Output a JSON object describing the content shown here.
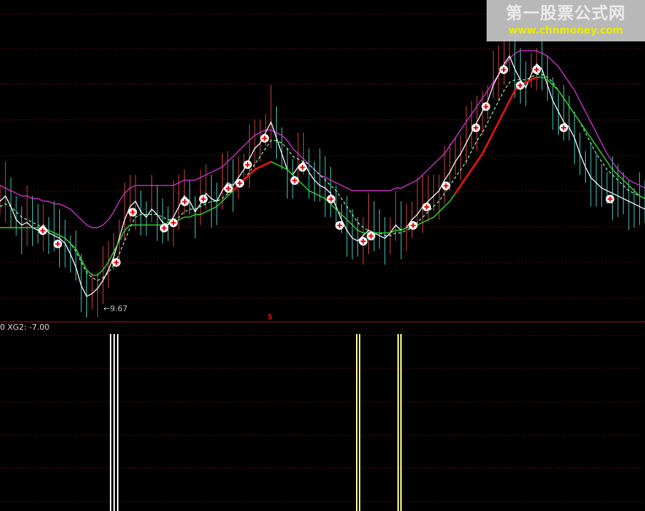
{
  "colors": {
    "background": "#000000",
    "grid": "#8b1a1a",
    "separator": "#b01818",
    "price_line": "#ffffff",
    "ma_dashed": "#8cffb0",
    "upper_band": "#cc33cc",
    "lower_support_green": "#33dd33",
    "lower_support_red": "#ee1111",
    "marker_fill": "#ffffff",
    "marker_cross": "#ee0000",
    "bar_white": "#ffffff",
    "bar_yellow": "#ffff88",
    "text_label": "#c0c0c0",
    "signal_red": "#ff2222"
  },
  "main_panel": {
    "low_label": "←9.67",
    "signal_marker": "$"
  },
  "indicator_panel": {
    "header": "0 XG2: -7.00"
  },
  "watermark": {
    "title": "第一股票公式网",
    "url": "www.chnmoney.com"
  },
  "chart_data": {
    "type": "line",
    "title": "",
    "xlabel": "",
    "ylabel": "",
    "note_values_relative": "y values relative to visible price range (0 = bottom, 100 = top of main panel)",
    "x": [
      0,
      1,
      2,
      3,
      4,
      5,
      6,
      7,
      8,
      9,
      10,
      11,
      12,
      13,
      14,
      15,
      16,
      17,
      18,
      19,
      20,
      21,
      22,
      23,
      24,
      25,
      26,
      27,
      28,
      29,
      30,
      31,
      32,
      33,
      34,
      35,
      36,
      37,
      38,
      39,
      40,
      41,
      42,
      43,
      44,
      45,
      46,
      47,
      48,
      49,
      50,
      51,
      52,
      53,
      54,
      55,
      56,
      57,
      58,
      59,
      60,
      61,
      62,
      63,
      64,
      65,
      66,
      67,
      68,
      69,
      70,
      71,
      72,
      73,
      74,
      75,
      76,
      77,
      78,
      79,
      80,
      81,
      82,
      83,
      84,
      85,
      86,
      87,
      88,
      89,
      90,
      91,
      92,
      93,
      94,
      95,
      96,
      97,
      98,
      99,
      100,
      101,
      102,
      103,
      104,
      105,
      106,
      107,
      108,
      109,
      110,
      111,
      112,
      113,
      114,
      115,
      116,
      117,
      118,
      119
    ],
    "series": [
      {
        "key": "price",
        "values": [
          40,
          42,
          38,
          33,
          31,
          32,
          30,
          29,
          31,
          28,
          27,
          26,
          24,
          20,
          15,
          8,
          4,
          5,
          7,
          10,
          14,
          19,
          26,
          33,
          38,
          40,
          36,
          34,
          37,
          35,
          32,
          31,
          34,
          38,
          42,
          40,
          36,
          39,
          43,
          41,
          40,
          44,
          47,
          46,
          49,
          52,
          56,
          60,
          62,
          66,
          70,
          64,
          58,
          52,
          50,
          53,
          55,
          51,
          48,
          46,
          45,
          43,
          38,
          33,
          29,
          26,
          25,
          27,
          29,
          28,
          27,
          26,
          28,
          31,
          29,
          30,
          33,
          35,
          38,
          40,
          42,
          44,
          48,
          51,
          55,
          58,
          62,
          66,
          70,
          74,
          78,
          84,
          88,
          92,
          95,
          90,
          86,
          83,
          88,
          92,
          90,
          84,
          78,
          74,
          70,
          68,
          64,
          58,
          53,
          49,
          47,
          45,
          44,
          43,
          42,
          41,
          40,
          39,
          38,
          37
        ]
      },
      {
        "key": "ma_dashed",
        "values": [
          38,
          39,
          38,
          36,
          34,
          33,
          32,
          31,
          30,
          29,
          28,
          27,
          26,
          24,
          21,
          17,
          13,
          11,
          10,
          11,
          13,
          16,
          20,
          25,
          30,
          34,
          35,
          35,
          35,
          35,
          34,
          33,
          33,
          34,
          36,
          37,
          37,
          38,
          39,
          40,
          40,
          41,
          43,
          44,
          46,
          48,
          51,
          54,
          57,
          60,
          63,
          63,
          62,
          60,
          57,
          56,
          55,
          54,
          52,
          50,
          48,
          46,
          44,
          41,
          38,
          35,
          32,
          30,
          29,
          28,
          28,
          27,
          27,
          28,
          28,
          29,
          30,
          32,
          34,
          36,
          38,
          40,
          43,
          46,
          49,
          52,
          55,
          59,
          63,
          66,
          70,
          74,
          78,
          82,
          85,
          86,
          86,
          86,
          87,
          88,
          88,
          87,
          85,
          82,
          79,
          76,
          73,
          70,
          66,
          62,
          58,
          55,
          52,
          50,
          48,
          46,
          44,
          43,
          42,
          41
        ]
      },
      {
        "key": "upper_band",
        "values": [
          46,
          45,
          44,
          43,
          42,
          42,
          41,
          41,
          40,
          40,
          39,
          39,
          38,
          37,
          35,
          33,
          31,
          30,
          30,
          31,
          33,
          36,
          40,
          43,
          45,
          46,
          46,
          46,
          46,
          46,
          46,
          46,
          46,
          47,
          48,
          48,
          48,
          49,
          50,
          51,
          52,
          53,
          55,
          57,
          59,
          61,
          63,
          65,
          66,
          67,
          67,
          66,
          65,
          63,
          60,
          58,
          56,
          54,
          52,
          50,
          49,
          48,
          47,
          46,
          45,
          44,
          44,
          44,
          44,
          44,
          44,
          44,
          44,
          45,
          45,
          46,
          47,
          48,
          50,
          52,
          54,
          56,
          58,
          61,
          64,
          67,
          70,
          73,
          76,
          79,
          82,
          85,
          88,
          91,
          94,
          96,
          97,
          97,
          97,
          97,
          96,
          95,
          93,
          91,
          88,
          85,
          82,
          78,
          74,
          70,
          66,
          62,
          58,
          55,
          52,
          50,
          48,
          47,
          46,
          45
        ]
      },
      {
        "key": "lower_support",
        "values": [
          30,
          30,
          30,
          30,
          30,
          30,
          30,
          30,
          30,
          29,
          28,
          27,
          26,
          24,
          22,
          18,
          14,
          12,
          12,
          14,
          17,
          21,
          25,
          29,
          31,
          31,
          31,
          31,
          31,
          31,
          31,
          32,
          32,
          33,
          34,
          34,
          35,
          35,
          36,
          37,
          38,
          40,
          42,
          44,
          46,
          48,
          50,
          52,
          53,
          54,
          55,
          54,
          53,
          52,
          50,
          48,
          46,
          44,
          43,
          42,
          41,
          39,
          37,
          35,
          33,
          31,
          29,
          28,
          28,
          28,
          28,
          28,
          28,
          29,
          29,
          30,
          30,
          31,
          32,
          33,
          34,
          36,
          38,
          40,
          43,
          46,
          49,
          52,
          55,
          58,
          62,
          66,
          70,
          74,
          78,
          82,
          84,
          85,
          86,
          87,
          87,
          86,
          84,
          82,
          79,
          76,
          73,
          70,
          67,
          64,
          61,
          58,
          55,
          52,
          50,
          48,
          46,
          44,
          42,
          41
        ]
      },
      {
        "key": "indicator_bars",
        "bar_positions_x": [
          155,
          160,
          165,
          500,
          504,
          558,
          562
        ],
        "bar_heights": [
          100,
          100,
          100,
          100,
          100,
          100,
          100
        ]
      }
    ],
    "markers": {
      "buy_signal_x": [
        60,
        81,
        163,
        186,
        230,
        243,
        259,
        285,
        320,
        336,
        347,
        371,
        413,
        424,
        464,
        476,
        509,
        520,
        579,
        598,
        625,
        667,
        681,
        706,
        729,
        752,
        790,
        855
      ],
      "low_point_x": 145
    }
  }
}
